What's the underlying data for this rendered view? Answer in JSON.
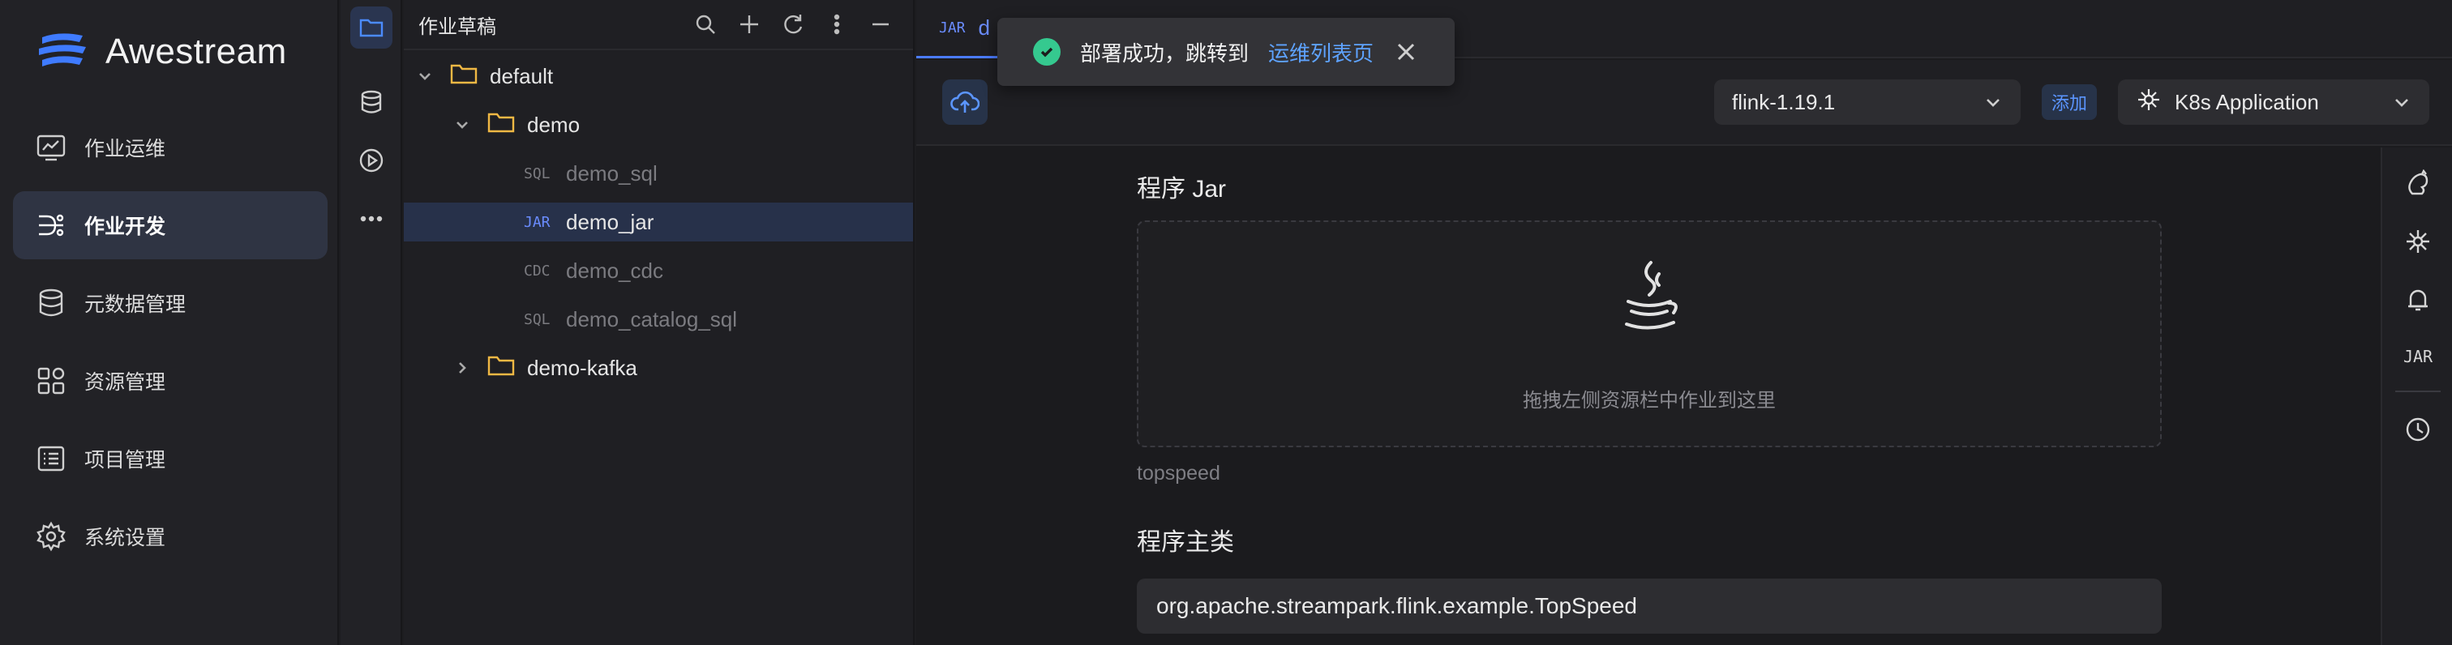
{
  "app": {
    "name": "Awestream"
  },
  "nav": {
    "items": [
      {
        "label": "作业运维",
        "icon": "chart-monitor-icon",
        "active": false
      },
      {
        "label": "作业开发",
        "icon": "flow-icon",
        "active": true
      },
      {
        "label": "元数据管理",
        "icon": "database-icon",
        "active": false
      },
      {
        "label": "资源管理",
        "icon": "grid-icon",
        "active": false
      },
      {
        "label": "项目管理",
        "icon": "list-icon",
        "active": false
      },
      {
        "label": "系统设置",
        "icon": "gear-icon",
        "active": false
      }
    ]
  },
  "activity": {
    "items": [
      "folder-icon",
      "database-icon",
      "play-icon",
      "more-icon"
    ]
  },
  "explorer": {
    "title": "作业草稿",
    "tools": [
      "search-icon",
      "plus-icon",
      "refresh-icon",
      "more-vertical-icon",
      "collapse-icon"
    ],
    "tree": [
      {
        "label": "default",
        "type": "folder",
        "expanded": true
      },
      {
        "label": "demo",
        "type": "folder",
        "expanded": true
      },
      {
        "label": "demo_sql",
        "type": "SQL"
      },
      {
        "label": "demo_jar",
        "type": "JAR",
        "selected": true
      },
      {
        "label": "demo_cdc",
        "type": "CDC"
      },
      {
        "label": "demo_catalog_sql",
        "type": "SQL"
      },
      {
        "label": "demo-kafka",
        "type": "folder",
        "expanded": false
      }
    ]
  },
  "editor": {
    "tab": {
      "type": "JAR",
      "name": "d"
    },
    "toolbar": {
      "flink_version": "flink-1.19.1",
      "add_label": "添加",
      "deploy_mode": "K8s Application"
    },
    "jar_section": {
      "title": "程序 Jar",
      "drop_hint": "拖拽左侧资源栏中作业到这里",
      "hint": "topspeed"
    },
    "main_class": {
      "title": "程序主类",
      "value": "org.apache.streampark.flink.example.TopSpeed"
    },
    "rail": {
      "jar_label": "JAR"
    }
  },
  "toast": {
    "message": "部署成功，跳转到",
    "link": "运维列表页"
  },
  "colors": {
    "accent": "#4b7cff",
    "success": "#35c98f",
    "folder": "#f0b844"
  }
}
